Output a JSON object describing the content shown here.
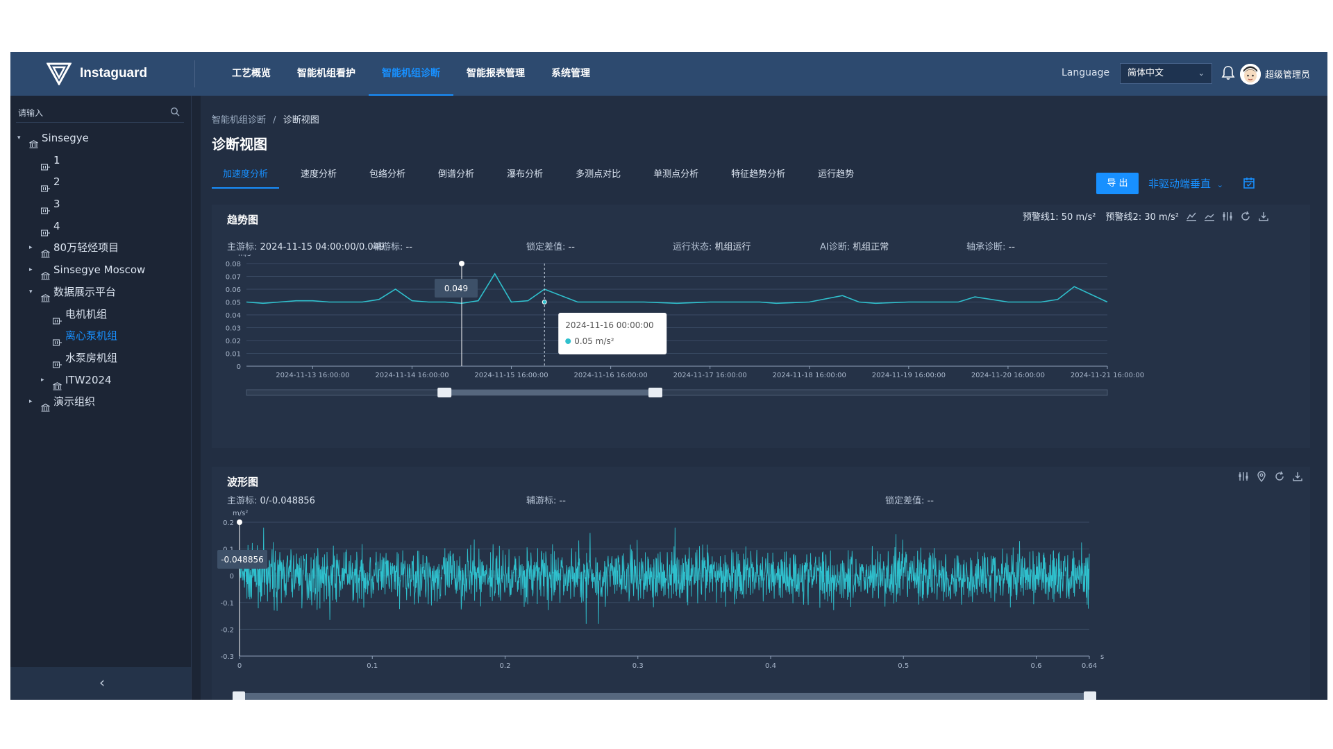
{
  "header": {
    "app_name": "Instaguard",
    "nav": [
      "工艺概览",
      "智能机组看护",
      "智能机组诊断",
      "智能报表管理",
      "系统管理"
    ],
    "active_nav": 2,
    "language_label": "Language",
    "language_value": "简体中文",
    "user_name": "超级管理员"
  },
  "sidebar": {
    "search_placeholder": "请输入",
    "tree": [
      {
        "label": "Sinsegye",
        "level": 0,
        "caret": "down",
        "icon": "bank-icon"
      },
      {
        "label": "1",
        "level": 1,
        "icon": "equipment-icon"
      },
      {
        "label": "2",
        "level": 1,
        "icon": "equipment-icon"
      },
      {
        "label": "3",
        "level": 1,
        "icon": "equipment-icon"
      },
      {
        "label": "4",
        "level": 1,
        "icon": "equipment-icon"
      },
      {
        "label": "80万轻烃项目",
        "level": 1,
        "caret": "right",
        "icon": "bank-icon"
      },
      {
        "label": "Sinsegye Moscow",
        "level": 1,
        "caret": "right",
        "icon": "bank-icon"
      },
      {
        "label": "数据展示平台",
        "level": 1,
        "caret": "down",
        "icon": "bank-icon"
      },
      {
        "label": "电机机组",
        "level": 2,
        "icon": "equipment-icon"
      },
      {
        "label": "离心泵机组",
        "level": 2,
        "icon": "equipment-icon",
        "selected": true
      },
      {
        "label": "水泵房机组",
        "level": 2,
        "icon": "equipment-icon"
      },
      {
        "label": "ITW2024",
        "level": 2,
        "caret": "right",
        "icon": "bank-icon"
      },
      {
        "label": "演示组织",
        "level": 1,
        "caret": "right",
        "icon": "bank-icon"
      }
    ],
    "collapse_icon": "‹"
  },
  "main": {
    "breadcrumb": {
      "parent": "智能机组诊断",
      "sep": "/",
      "current": "诊断视图"
    },
    "title": "诊断视图",
    "tabs": [
      "加速度分析",
      "速度分析",
      "包络分析",
      "倒谱分析",
      "瀑布分析",
      "多测点对比",
      "单测点分析",
      "特征趋势分析",
      "运行趋势"
    ],
    "active_tab": 0,
    "export_label": "导 出",
    "direction_label": "非驱动端垂直",
    "direction_chevron": "⌄"
  },
  "trend_panel": {
    "title": "趋势图",
    "warn1": "预警线1: 50 m/s²",
    "warn2": "预警线2: 30 m/s²",
    "info": [
      {
        "k": "主游标:",
        "v": "2024-11-15 04:00:00/0.049"
      },
      {
        "k": "辅游标:",
        "v": "--"
      },
      {
        "k": "锁定差值:",
        "v": "--"
      },
      {
        "k": "运行状态:",
        "v": "机组运行"
      },
      {
        "k": "AI诊断:",
        "v": "机组正常"
      },
      {
        "k": "轴承诊断:",
        "v": "--"
      }
    ]
  },
  "waveform_panel": {
    "title": "波形图",
    "info": [
      {
        "k": "主游标:",
        "v": "0/-0.048856"
      },
      {
        "k": "辅游标:",
        "v": "--"
      },
      {
        "k": "锁定差值:",
        "v": "--"
      }
    ]
  },
  "chart_data": [
    {
      "type": "line",
      "ylabel": "m/s²",
      "ylim": [
        0,
        0.08
      ],
      "yticks": [
        "0.08",
        "0.07",
        "0.06",
        "0.05",
        "0.04",
        "0.03",
        "0.02",
        "0.01",
        "0"
      ],
      "x_tick_labels": [
        "2024-11-13 16:00:00",
        "2024-11-14 16:00:00",
        "2024-11-15 16:00:00",
        "2024-11-16 16:00:00",
        "2024-11-17 16:00:00",
        "2024-11-18 16:00:00",
        "2024-11-19 16:00:00",
        "2024-11-20 16:00:00",
        "2024-11-21 16:00:00"
      ],
      "x_start": "2024-11-13 00:00:00",
      "x_end": "2024-11-21 16:00:00",
      "series": [
        {
          "name": "",
          "color": "#2fc0cd",
          "x": [
            "2024-11-13 00:00:00",
            "2024-11-13 04:00:00",
            "2024-11-13 08:00:00",
            "2024-11-13 12:00:00",
            "2024-11-13 16:00:00",
            "2024-11-13 20:00:00",
            "2024-11-14 00:00:00",
            "2024-11-14 04:00:00",
            "2024-11-14 08:00:00",
            "2024-11-14 12:00:00",
            "2024-11-14 16:00:00",
            "2024-11-14 20:00:00",
            "2024-11-15 00:00:00",
            "2024-11-15 04:00:00",
            "2024-11-15 08:00:00",
            "2024-11-15 12:00:00",
            "2024-11-15 16:00:00",
            "2024-11-15 20:00:00",
            "2024-11-16 00:00:00",
            "2024-11-16 08:00:00",
            "2024-11-16 16:00:00",
            "2024-11-17 00:00:00",
            "2024-11-17 08:00:00",
            "2024-11-17 16:00:00",
            "2024-11-18 00:00:00",
            "2024-11-18 04:00:00",
            "2024-11-18 08:00:00",
            "2024-11-18 16:00:00",
            "2024-11-19 00:00:00",
            "2024-11-19 04:00:00",
            "2024-11-19 08:00:00",
            "2024-11-19 16:00:00",
            "2024-11-20 00:00:00",
            "2024-11-20 04:00:00",
            "2024-11-20 08:00:00",
            "2024-11-20 16:00:00",
            "2024-11-21 00:00:00",
            "2024-11-21 04:00:00",
            "2024-11-21 08:00:00",
            "2024-11-21 16:00:00"
          ],
          "values": [
            0.05,
            0.049,
            0.05,
            0.051,
            0.051,
            0.05,
            0.05,
            0.05,
            0.052,
            0.06,
            0.051,
            0.05,
            0.05,
            0.049,
            0.051,
            0.072,
            0.05,
            0.051,
            0.06,
            0.05,
            0.05,
            0.05,
            0.049,
            0.05,
            0.05,
            0.05,
            0.049,
            0.05,
            0.055,
            0.05,
            0.049,
            0.05,
            0.05,
            0.05,
            0.054,
            0.05,
            0.05,
            0.052,
            0.062,
            0.05
          ]
        }
      ],
      "cursor": {
        "time": "2024-11-15 04:00:00",
        "value": "0.049"
      },
      "tooltip": {
        "time": "2024-11-16 00:00:00",
        "value": "0.05 m/s²"
      },
      "zoom_range": [
        0.23,
        0.475
      ]
    },
    {
      "type": "line",
      "ylabel": "m/s²",
      "xlabel": "s",
      "ylim": [
        -0.3,
        0.2
      ],
      "yticks": [
        "0.2",
        "0.1",
        "0",
        "-0.1",
        "-0.2",
        "-0.3"
      ],
      "x_tick_labels": [
        "0",
        "0.1",
        "0.2",
        "0.3",
        "0.4",
        "0.5",
        "0.6",
        "0.64"
      ],
      "xlim": [
        0,
        0.64
      ],
      "series": [
        {
          "name": "",
          "color": "#2fc0cd",
          "amplitude_rms": 0.045,
          "peak": 0.18
        }
      ],
      "cursor": {
        "x": "0",
        "value": "-0.048856"
      }
    }
  ]
}
